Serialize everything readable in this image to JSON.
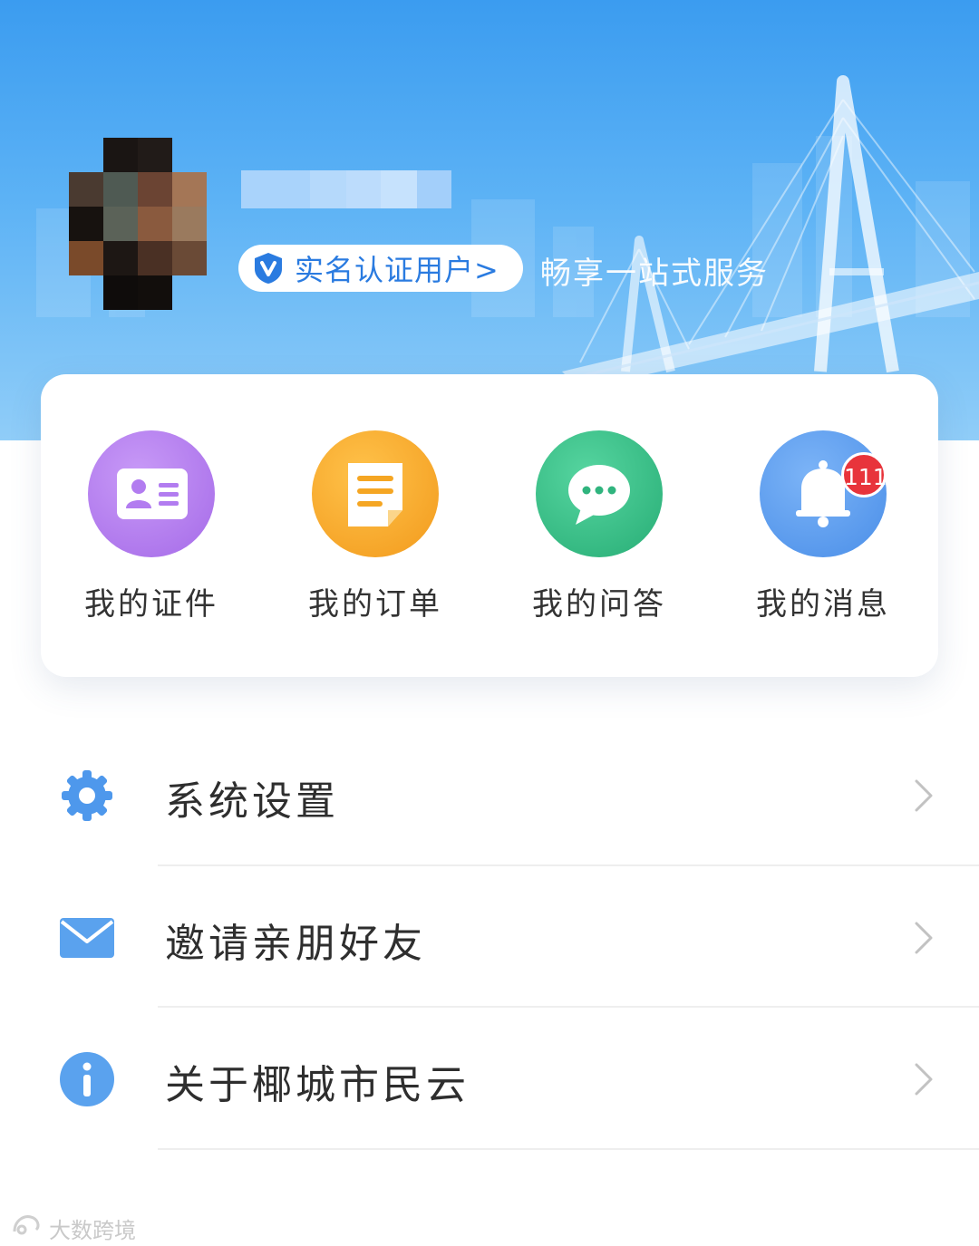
{
  "profile": {
    "verify_label": "实名认证用户>",
    "slogan": "畅享一站式服务"
  },
  "quick_actions": [
    {
      "label": "我的证件",
      "icon": "id-card-icon",
      "color": "#b57cf0"
    },
    {
      "label": "我的订单",
      "icon": "order-note-icon",
      "color": "#f5a623"
    },
    {
      "label": "我的问答",
      "icon": "chat-bubble-icon",
      "color": "#3cc08a"
    },
    {
      "label": "我的消息",
      "icon": "bell-icon",
      "color": "#5b9cf0",
      "badge": "111"
    }
  ],
  "menu": [
    {
      "label": "系统设置",
      "icon": "gear-icon"
    },
    {
      "label": "邀请亲朋好友",
      "icon": "mail-icon"
    },
    {
      "label": "关于椰城市民云",
      "icon": "info-icon"
    }
  ],
  "watermark": "大数跨境",
  "colors": {
    "header_top": "#3b9cf0",
    "header_bottom": "#90cdf8",
    "accent": "#2a7be0",
    "badge": "#e8343b"
  }
}
